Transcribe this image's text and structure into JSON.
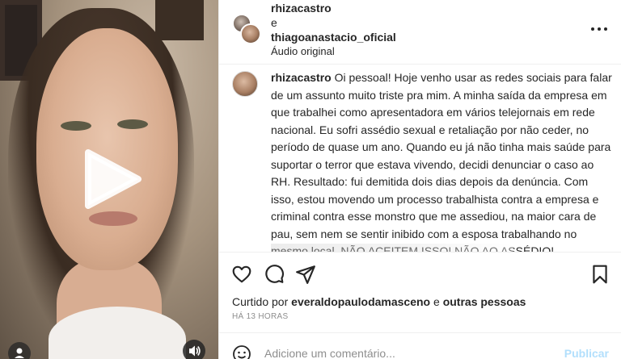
{
  "header": {
    "user1": "rhizacastro",
    "conjunction": "e",
    "user2": "thiagoanastacio_oficial",
    "audio": "Áudio original",
    "more_icon": "more-horizontal-icon"
  },
  "caption": {
    "username": "rhizacastro",
    "text": "Oi pessoal! Hoje venho usar as redes sociais para falar de um assunto muito triste pra mim. A minha saída da empresa em que trabalhei como apresentadora em vários telejornais em rede nacional. Eu sofri assédio sexual e retaliação por não ceder, no período de quase um ano. Quando eu já não tinha mais saúde para suportar o terror que estava vivendo, decidi denunciar o caso ao RH. Resultado: fui demitida dois dias depois da denúncia. Com isso, estou movendo um processo trabalhista contra a empresa e criminal contra esse monstro que me assediou, na maior cara de pau, sem nem se sentir inibido com a esposa trabalhando no mesmo local. NÃO ACEITEM ISSO! NÃO AO ASSÉDIO!"
  },
  "actions": {
    "like_icon": "heart-icon",
    "comment_icon": "comment-icon",
    "share_icon": "send-icon",
    "save_icon": "bookmark-icon"
  },
  "likes": {
    "prefix": "Curtido por",
    "user": "everaldopaulodamasceno",
    "middle": "e",
    "others": "outras pessoas"
  },
  "time": "HÁ 13 HORAS",
  "comment_bar": {
    "placeholder": "Adicione um comentário...",
    "publish": "Publicar",
    "emoji_icon": "emoji-icon"
  },
  "media": {
    "play_icon": "play-icon",
    "user_icon": "user-tag-icon",
    "audio_icon": "audio-icon"
  },
  "colors": {
    "publish_disabled": "#b2dffc",
    "secondary_text": "#8e8e8e",
    "border": "#efefef"
  }
}
